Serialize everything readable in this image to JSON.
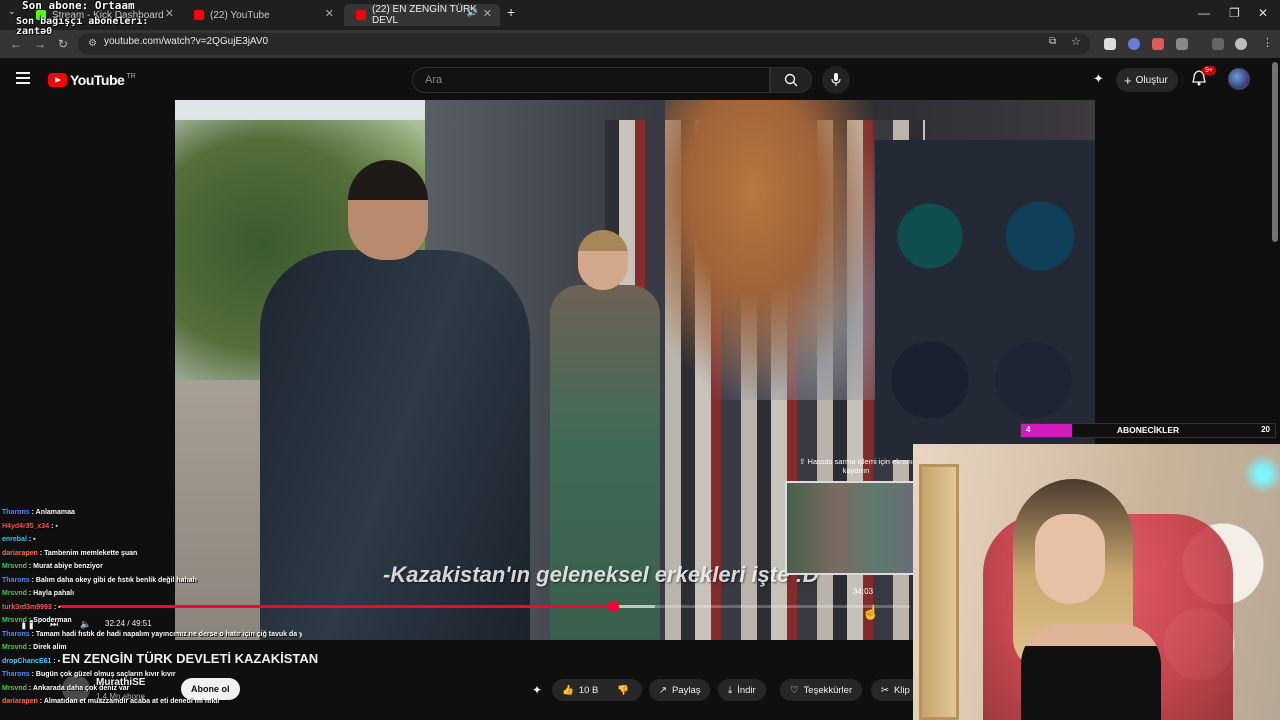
{
  "browser": {
    "tabs": [
      {
        "title": "Stream - Kick Dashboard",
        "favicon_color": "#53fc18"
      },
      {
        "title": "(22) YouTube",
        "favicon_color": "#ff0000"
      },
      {
        "title": "(22) EN ZENGİN TÜRK DEVL",
        "favicon_color": "#ff0000",
        "active": true
      }
    ],
    "new_tab": "+",
    "url": "youtube.com/watch?v=2QGujE3jAV0"
  },
  "stream_overlay": {
    "last_subscriber": "Son abone: Ortaam",
    "last_donor": "Son bağışçı aboneleri:",
    "donor_name": "zantə0"
  },
  "youtube": {
    "logo_text": "YouTube",
    "country": "TR",
    "search_placeholder": "Ara",
    "create_label": "Oluştur",
    "notification_count": "9+",
    "video": {
      "subtitle": "-Kazakistan'ın geleneksel erkekleri işte :D",
      "pip_hint": "⇧ Hassas sarma işlemi için ekranı kaydırın",
      "pip_time": "34:03",
      "current_time": "32:24 / 49:51",
      "progress_fraction": 0.65,
      "buffer_fraction": 0.7
    },
    "title": "EN ZENGİN TÜRK DEVLETİ KAZAKİSTAN",
    "channel": {
      "name": "MurathiSE",
      "subscribers": "1,4 Mn abone",
      "subscribe_label": "Abone ol"
    },
    "actions": {
      "likes": "10 B",
      "share": "Paylaş",
      "download": "İndir",
      "thanks": "Teşekkürler",
      "clip": "Klip"
    }
  },
  "chat": [
    {
      "user": "Tharons",
      "msg": ": Anlamamaa",
      "color": "#4f8cff"
    },
    {
      "user": "H4yd4r35_x34",
      "msg": ": ▪",
      "color": "#ff4d4d"
    },
    {
      "user": "enrebal",
      "msg": ": ▪",
      "color": "#37c5ff"
    },
    {
      "user": "dariarapen",
      "msg": ": Tambenim memlekette şuan",
      "color": "#ff6f3c"
    },
    {
      "user": "Mrsvnd",
      "msg": ": Murat abiye benziyor",
      "color": "#37d64f"
    },
    {
      "user": "Tharons",
      "msg": ": Balım daha okey gibi de fıstık benlik değil hahah",
      "color": "#4f8cff"
    },
    {
      "user": "Mrsvnd",
      "msg": ": Hayla pahalı",
      "color": "#37d64f"
    },
    {
      "user": "turk3rd3m9993",
      "msg": ": ▪",
      "color": "#ff5a5a"
    },
    {
      "user": "Mrsvnd",
      "msg": ": Spoderman",
      "color": "#37d64f"
    },
    {
      "user": "Tharons",
      "msg": ": Tamam hadi fıstık de hadi napalım yayıncımız ne derse o hatır için çiğ tavuk da yenir",
      "color": "#4f8cff"
    },
    {
      "user": "Mrsvnd",
      "msg": ": Direk alim",
      "color": "#37d64f"
    },
    {
      "user": "dropChancE61",
      "msg": ": ▪",
      "color": "#3ad1ff"
    },
    {
      "user": "Tharons",
      "msg": ": Bugün çok güzel olmuş saçların kıvır kıvır",
      "color": "#4f8cff"
    },
    {
      "user": "Mrsvnd",
      "msg": ": Ankarada daha çok deniz var",
      "color": "#37d64f"
    },
    {
      "user": "dariarapen",
      "msg": ": Almatıdan et muazzamdır acaba at eti denedi mi nfklı",
      "color": "#ff6f3c"
    }
  ],
  "sub_goal": {
    "current": "4",
    "label": "ABONECİKLER",
    "target": "20",
    "fraction": 0.2
  },
  "colors": {
    "accent_red": "#ff0033",
    "goal_fill": "#d11abf",
    "background": "#0f0f0f"
  }
}
